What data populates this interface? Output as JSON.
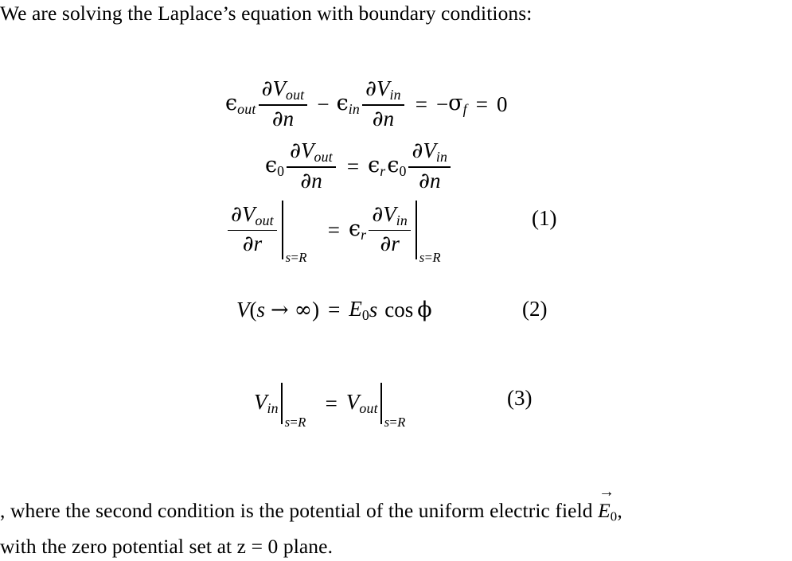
{
  "document": {
    "background_color": "#ffffff",
    "text_color": "#000000",
    "intro_paragraph": "We are solving the Laplace’s equation with boundary conditions:",
    "closing_paragraph_line1_before_vector": ", where the second condition is the potential of the uniform electric field ",
    "closing_vector_symbol": "E",
    "closing_vector_subscript": "0",
    "closing_vector_accent": "→",
    "closing_paragraph_line1_after_vector": ",",
    "closing_paragraph_line2": "with the zero potential set at z = 0 plane."
  },
  "equations": {
    "eq1": {
      "tag": "(1)",
      "line1": {
        "term1_epsilon": "ϵ",
        "term1_subscript": "out",
        "frac1_numerator_partial": "∂",
        "frac1_numerator_var": "V",
        "frac1_numerator_sub": "out",
        "frac1_denominator_partial": "∂",
        "frac1_denominator_var": "n",
        "operator_minus": "−",
        "term2_epsilon": "ϵ",
        "term2_subscript": "in",
        "frac2_numerator_partial": "∂",
        "frac2_numerator_var": "V",
        "frac2_numerator_sub": "in",
        "frac2_denominator_partial": "∂",
        "frac2_denominator_var": "n",
        "equals": "=",
        "rhs_minus": "−",
        "rhs_sigma": "σ",
        "rhs_sigma_sub": "f",
        "equals2": "=",
        "rhs_value": "0"
      },
      "line2": {
        "lhs_epsilon": "ϵ",
        "lhs_epsilon_sub": "0",
        "frac1_numerator_partial": "∂",
        "frac1_numerator_var": "V",
        "frac1_numerator_sub": "out",
        "frac1_denominator_partial": "∂",
        "frac1_denominator_var": "n",
        "equals": "=",
        "rhs_epsilon_r": "ϵ",
        "rhs_epsilon_r_sub": "r",
        "rhs_epsilon_0": "ϵ",
        "rhs_epsilon_0_sub": "0",
        "frac2_numerator_partial": "∂",
        "frac2_numerator_var": "V",
        "frac2_numerator_sub": "in",
        "frac2_denominator_partial": "∂",
        "frac2_denominator_var": "n"
      },
      "line3": {
        "frac1_numerator_partial": "∂",
        "frac1_numerator_var": "V",
        "frac1_numerator_sub": "out",
        "frac1_denominator_partial": "∂",
        "frac1_denominator_var": "r",
        "eval1_condition_var": "s",
        "eval1_condition_eq": "=",
        "eval1_condition_val": "R",
        "equals": "=",
        "rhs_epsilon": "ϵ",
        "rhs_epsilon_sub": "r",
        "frac2_numerator_partial": "∂",
        "frac2_numerator_var": "V",
        "frac2_numerator_sub": "in",
        "frac2_denominator_partial": "∂",
        "frac2_denominator_var": "r",
        "eval2_condition_var": "s",
        "eval2_condition_eq": "=",
        "eval2_condition_val": "R"
      }
    },
    "eq2": {
      "tag": "(2)",
      "lhs_var": "V",
      "lhs_open_paren": "(",
      "lhs_arg": "s",
      "lhs_arrow": "→",
      "lhs_infinity": "∞",
      "lhs_close_paren": ")",
      "equals": "=",
      "rhs_E": "E",
      "rhs_E_sub": "0",
      "rhs_s": "s",
      "rhs_cos": "cos",
      "rhs_phi": "ϕ"
    },
    "eq3": {
      "tag": "(3)",
      "lhs_var": "V",
      "lhs_sub": "in",
      "lhs_condition_var": "s",
      "lhs_condition_eq": "=",
      "lhs_condition_val": "R",
      "equals": "=",
      "rhs_var": "V",
      "rhs_sub": "out",
      "rhs_condition_var": "s",
      "rhs_condition_eq": "=",
      "rhs_condition_val": "R"
    }
  }
}
